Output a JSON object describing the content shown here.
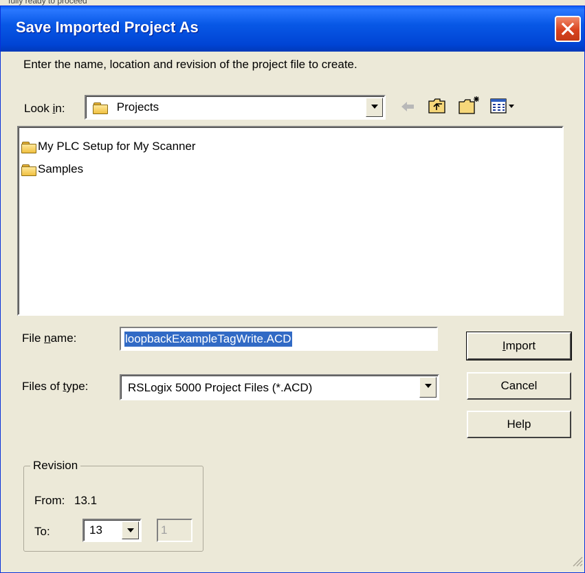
{
  "top_strip_text": "fully ready to proceed",
  "dialog": {
    "title": "Save Imported Project As",
    "description": "Enter the name, location and revision of the project file to create.",
    "close_symbol": "×"
  },
  "look_in": {
    "label_pre": "Look ",
    "label_mnemonic": "i",
    "label_post": "n:",
    "value": "Projects",
    "icon": "folder-icon"
  },
  "toolbar": {
    "back_icon": "back-arrow-icon",
    "up_icon": "up-folder-icon",
    "new_folder_icon": "new-folder-icon",
    "view_icon": "view-menu-icon"
  },
  "file_list": {
    "items": [
      {
        "name": "My PLC Setup for My Scanner",
        "icon": "folder-icon"
      },
      {
        "name": "Samples",
        "icon": "folder-icon"
      }
    ]
  },
  "file_name": {
    "label_pre": "File ",
    "label_mnemonic": "n",
    "label_post": "ame:",
    "value": "loopbackExampleTagWrite.ACD"
  },
  "files_of_type": {
    "label_pre": "Files of ",
    "label_mnemonic": "t",
    "label_post": "ype:",
    "value": "RSLogix 5000 Project Files (*.ACD)"
  },
  "buttons": {
    "import_mnemonic": "I",
    "import_rest": "mport",
    "cancel": "Cancel",
    "help": "Help"
  },
  "revision": {
    "group_title": "Revision",
    "from_label": "From:",
    "from_value": "13.1",
    "to_label": "To:",
    "to_value": "13",
    "minor_value": "1"
  },
  "colors": {
    "titlebar": "#0054e3",
    "dialog_bg": "#ece9d8",
    "selection": "#316ac5",
    "close_button": "#d9431e"
  }
}
